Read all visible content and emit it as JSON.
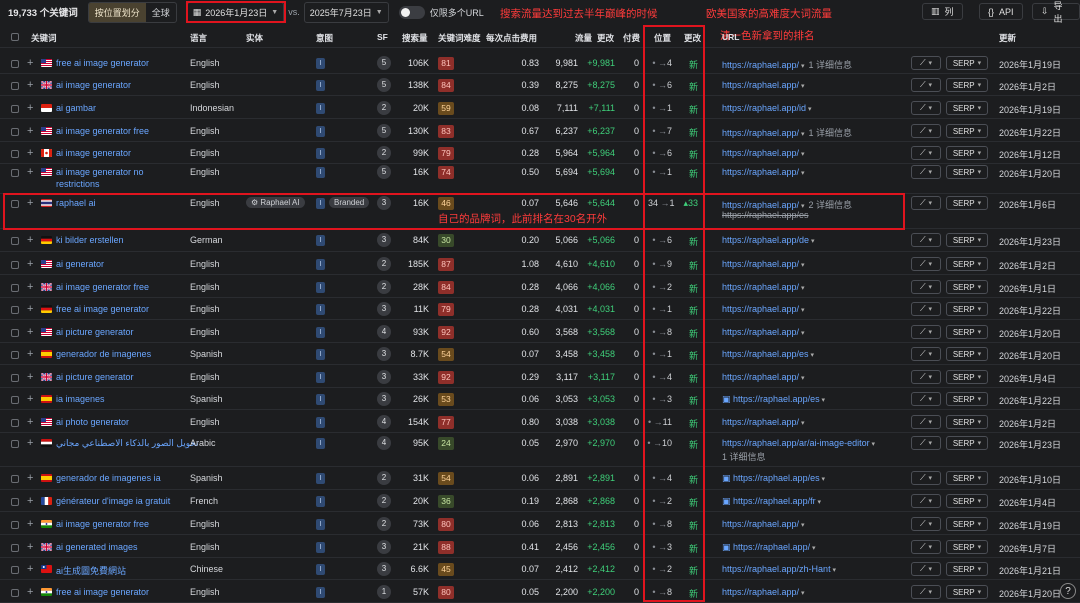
{
  "toolbar": {
    "count": "19,733 个关键词",
    "seg_on": "按位置划分",
    "seg_off": "全球",
    "date_current": "2026年1月23日",
    "vs": "vs.",
    "date_compare": "2025年7月23日",
    "toggle_label": "仅限多个URL",
    "btn_columns": "列",
    "btn_api": "API",
    "btn_export": "导出"
  },
  "annotations": {
    "peak": "搜索流量达到过去半年巅峰的时候",
    "western": "欧美国家的高难度大词流量",
    "new_rank": "清一色新拿到的排名",
    "brand": "自己的品牌词，此前排名在30名开外"
  },
  "headers": {
    "keyword": "关键词",
    "lang": "语言",
    "entity": "实体",
    "intent": "意图",
    "sf": "SF",
    "volume": "搜索量",
    "kd": "关键词难度",
    "cpc": "每次点击费用",
    "traffic": "流量",
    "change": "更改",
    "paid": "付费",
    "position": "位置",
    "pos_change": "更改",
    "url": "URL",
    "updated": "更新"
  },
  "colors": {
    "accent": "#6aa6ff",
    "positive": "#3fd07a",
    "annotation": "#ff3b3b",
    "kd_red": "#8f2f2a",
    "kd_orange": "#6a4b1d",
    "kd_green": "#384a2a"
  },
  "rows": [
    {
      "flag": "us",
      "kw": "free ai image generator",
      "lang": "English",
      "intent": "I",
      "sf": "5",
      "vol": "106K",
      "kd": "81",
      "kdc": "red",
      "cpc": "0.83",
      "traffic": "9,981",
      "chg": "+9,981",
      "paid": "0",
      "pos": "4",
      "pchg": "新",
      "url": "https://raphael.app/",
      "urlx": "1 详细信息",
      "date": "2026年1月19日"
    },
    {
      "flag": "gb",
      "kw": "ai image generator",
      "lang": "English",
      "intent": "I",
      "sf": "5",
      "vol": "138K",
      "kd": "84",
      "kdc": "red",
      "cpc": "0.39",
      "traffic": "8,275",
      "chg": "+8,275",
      "paid": "0",
      "pos": "6",
      "pchg": "新",
      "url": "https://raphael.app/",
      "urlx": "",
      "date": "2026年1月2日"
    },
    {
      "flag": "id",
      "kw": "ai gambar",
      "lang": "Indonesian",
      "intent": "I",
      "sf": "2",
      "vol": "20K",
      "kd": "59",
      "kdc": "org",
      "cpc": "0.08",
      "traffic": "7,111",
      "chg": "+7,111",
      "paid": "0",
      "pos": "1",
      "pchg": "新",
      "url": "https://raphael.app/id",
      "urlx": "",
      "date": "2026年1月19日"
    },
    {
      "flag": "us",
      "kw": "ai image generator free",
      "lang": "English",
      "intent": "I",
      "sf": "5",
      "vol": "130K",
      "kd": "83",
      "kdc": "red",
      "cpc": "0.67",
      "traffic": "6,237",
      "chg": "+6,237",
      "paid": "0",
      "pos": "7",
      "pchg": "新",
      "url": "https://raphael.app/",
      "urlx": "1 详细信息",
      "date": "2026年1月22日"
    },
    {
      "flag": "ca",
      "kw": "ai image generator",
      "lang": "English",
      "intent": "I",
      "sf": "2",
      "vol": "99K",
      "kd": "79",
      "kdc": "red",
      "cpc": "0.28",
      "traffic": "5,964",
      "chg": "+5,964",
      "paid": "0",
      "pos": "6",
      "pchg": "新",
      "url": "https://raphael.app/",
      "urlx": "",
      "date": "2026年1月12日"
    },
    {
      "flag": "us",
      "kw": "ai image generator no",
      "kw2": "restrictions",
      "lang": "English",
      "intent": "I",
      "sf": "5",
      "vol": "16K",
      "kd": "74",
      "kdc": "red",
      "cpc": "0.50",
      "traffic": "5,694",
      "chg": "+5,694",
      "paid": "0",
      "pos": "1",
      "pchg": "新",
      "url": "https://raphael.app/",
      "urlx": "",
      "date": "2026年1月20日"
    },
    {
      "flag": "th",
      "kw": "raphael ai",
      "lang": "English",
      "entity": "Raphael AI",
      "intent": "I",
      "branded": "Branded",
      "sf": "3",
      "vol": "16K",
      "kd": "46",
      "kdc": "org",
      "cpc": "0.07",
      "traffic": "5,646",
      "chg": "+5,644",
      "paid": "0",
      "pos": "1",
      "posfrom": "34",
      "pchg": "33",
      "url": "https://raphael.app/",
      "urlx": "2 详细信息",
      "url2": "https://raphael.app/es",
      "date": "2026年1月6日"
    },
    {
      "flag": "de",
      "kw": "ki bilder erstellen",
      "lang": "German",
      "intent": "I",
      "sf": "3",
      "vol": "84K",
      "kd": "30",
      "kdc": "grn",
      "cpc": "0.20",
      "traffic": "5,066",
      "chg": "+5,066",
      "paid": "0",
      "pos": "6",
      "pchg": "新",
      "url": "https://raphael.app/de",
      "urlx": "",
      "date": "2026年1月23日"
    },
    {
      "flag": "us",
      "kw": "ai generator",
      "lang": "English",
      "intent": "I",
      "sf": "2",
      "vol": "185K",
      "kd": "87",
      "kdc": "red",
      "cpc": "1.08",
      "traffic": "4,610",
      "chg": "+4,610",
      "paid": "0",
      "pos": "9",
      "pchg": "新",
      "url": "https://raphael.app/",
      "urlx": "",
      "date": "2026年1月2日"
    },
    {
      "flag": "gb",
      "kw": "ai image generator free",
      "lang": "English",
      "intent": "I",
      "sf": "2",
      "vol": "28K",
      "kd": "84",
      "kdc": "red",
      "cpc": "0.28",
      "traffic": "4,066",
      "chg": "+4,066",
      "paid": "0",
      "pos": "2",
      "pchg": "新",
      "url": "https://raphael.app/",
      "urlx": "",
      "date": "2026年1月1日"
    },
    {
      "flag": "de",
      "kw": "free ai image generator",
      "lang": "English",
      "intent": "I",
      "sf": "3",
      "vol": "11K",
      "kd": "79",
      "kdc": "red",
      "cpc": "0.28",
      "traffic": "4,031",
      "chg": "+4,031",
      "paid": "0",
      "pos": "1",
      "pchg": "新",
      "url": "https://raphael.app/",
      "urlx": "",
      "date": "2026年1月22日"
    },
    {
      "flag": "us",
      "kw": "ai picture generator",
      "lang": "English",
      "intent": "I",
      "sf": "4",
      "vol": "93K",
      "kd": "92",
      "kdc": "red",
      "cpc": "0.60",
      "traffic": "3,568",
      "chg": "+3,568",
      "paid": "0",
      "pos": "8",
      "pchg": "新",
      "url": "https://raphael.app/",
      "urlx": "",
      "date": "2026年1月20日"
    },
    {
      "flag": "es",
      "kw": "generador de imagenes",
      "lang": "Spanish",
      "intent": "I",
      "sf": "3",
      "vol": "8.7K",
      "kd": "54",
      "kdc": "org",
      "cpc": "0.07",
      "traffic": "3,458",
      "chg": "+3,458",
      "paid": "0",
      "pos": "1",
      "pchg": "新",
      "url": "https://raphael.app/es",
      "urlx": "",
      "date": "2026年1月20日"
    },
    {
      "flag": "gb",
      "kw": "ai picture generator",
      "lang": "English",
      "intent": "I",
      "sf": "3",
      "vol": "33K",
      "kd": "92",
      "kdc": "red",
      "cpc": "0.29",
      "traffic": "3,117",
      "chg": "+3,117",
      "paid": "0",
      "pos": "4",
      "pchg": "新",
      "url": "https://raphael.app/",
      "urlx": "",
      "date": "2026年1月4日"
    },
    {
      "flag": "es",
      "kw": "ia imagenes",
      "lang": "Spanish",
      "intent": "I",
      "sf": "3",
      "vol": "26K",
      "kd": "53",
      "kdc": "org",
      "cpc": "0.06",
      "traffic": "3,053",
      "chg": "+3,053",
      "paid": "0",
      "pos": "3",
      "pchg": "新",
      "url": "https://raphael.app/es",
      "img": true,
      "urlx": "",
      "date": "2026年1月22日"
    },
    {
      "flag": "us",
      "kw": "ai photo generator",
      "lang": "English",
      "intent": "I",
      "sf": "4",
      "vol": "154K",
      "kd": "77",
      "kdc": "red",
      "cpc": "0.80",
      "traffic": "3,038",
      "chg": "+3,038",
      "paid": "0",
      "pos": "11",
      "pchg": "新",
      "url": "https://raphael.app/",
      "urlx": "",
      "date": "2026年1月2日"
    },
    {
      "flag": "eg",
      "kw": "تحويل الصور بالذكاء الاصطناعي مجاني",
      "lang": "Arabic",
      "intent": "I",
      "sf": "4",
      "vol": "95K",
      "kd": "24",
      "kdc": "grn",
      "cpc": "0.05",
      "traffic": "2,970",
      "chg": "+2,970",
      "paid": "0",
      "pos": "10",
      "pchg": "新",
      "url": "https://raphael.app/ar/ai-image-editor",
      "urlx": "",
      "urlsub": "1 详细信息",
      "date": "2026年1月23日"
    },
    {
      "flag": "es",
      "kw": "generador de imagenes ia",
      "lang": "Spanish",
      "intent": "I",
      "sf": "2",
      "vol": "31K",
      "kd": "54",
      "kdc": "org",
      "cpc": "0.06",
      "traffic": "2,891",
      "chg": "+2,891",
      "paid": "0",
      "pos": "4",
      "pchg": "新",
      "url": "https://raphael.app/es",
      "img": true,
      "urlx": "",
      "date": "2026年1月10日"
    },
    {
      "flag": "fr",
      "kw": "générateur d'image ia gratuit",
      "lang": "French",
      "intent": "I",
      "sf": "2",
      "vol": "20K",
      "kd": "36",
      "kdc": "grn",
      "cpc": "0.19",
      "traffic": "2,868",
      "chg": "+2,868",
      "paid": "0",
      "pos": "2",
      "pchg": "新",
      "url": "https://raphael.app/fr",
      "img": true,
      "urlx": "",
      "date": "2026年1月4日"
    },
    {
      "flag": "in",
      "kw": "ai image generator free",
      "lang": "English",
      "intent": "I",
      "sf": "2",
      "vol": "73K",
      "kd": "80",
      "kdc": "red",
      "cpc": "0.06",
      "traffic": "2,813",
      "chg": "+2,813",
      "paid": "0",
      "pos": "8",
      "pchg": "新",
      "url": "https://raphael.app/",
      "urlx": "",
      "date": "2026年1月19日"
    },
    {
      "flag": "gb",
      "kw": "ai generated images",
      "lang": "English",
      "intent": "I",
      "sf": "3",
      "vol": "21K",
      "kd": "88",
      "kdc": "red",
      "cpc": "0.41",
      "traffic": "2,456",
      "chg": "+2,456",
      "paid": "0",
      "pos": "3",
      "pchg": "新",
      "url": "https://raphael.app/",
      "img": true,
      "urlx": "",
      "date": "2026年1月7日"
    },
    {
      "flag": "tw",
      "kw": "ai生成圖免費網站",
      "lang": "Chinese",
      "intent": "I",
      "sf": "3",
      "vol": "6.6K",
      "kd": "45",
      "kdc": "org",
      "cpc": "0.07",
      "traffic": "2,412",
      "chg": "+2,412",
      "paid": "0",
      "pos": "2",
      "pchg": "新",
      "url": "https://raphael.app/zh-Hant",
      "urlx": "",
      "date": "2026年1月21日"
    },
    {
      "flag": "in",
      "kw": "free ai image generator",
      "lang": "English",
      "intent": "I",
      "sf": "1",
      "vol": "57K",
      "kd": "80",
      "kdc": "red",
      "cpc": "0.05",
      "traffic": "2,200",
      "chg": "+2,200",
      "paid": "0",
      "pos": "8",
      "pchg": "新",
      "url": "https://raphael.app/",
      "urlx": "",
      "date": "2026年1月20日"
    }
  ],
  "row_buttons": {
    "trend": "~",
    "serp": "SERP"
  }
}
